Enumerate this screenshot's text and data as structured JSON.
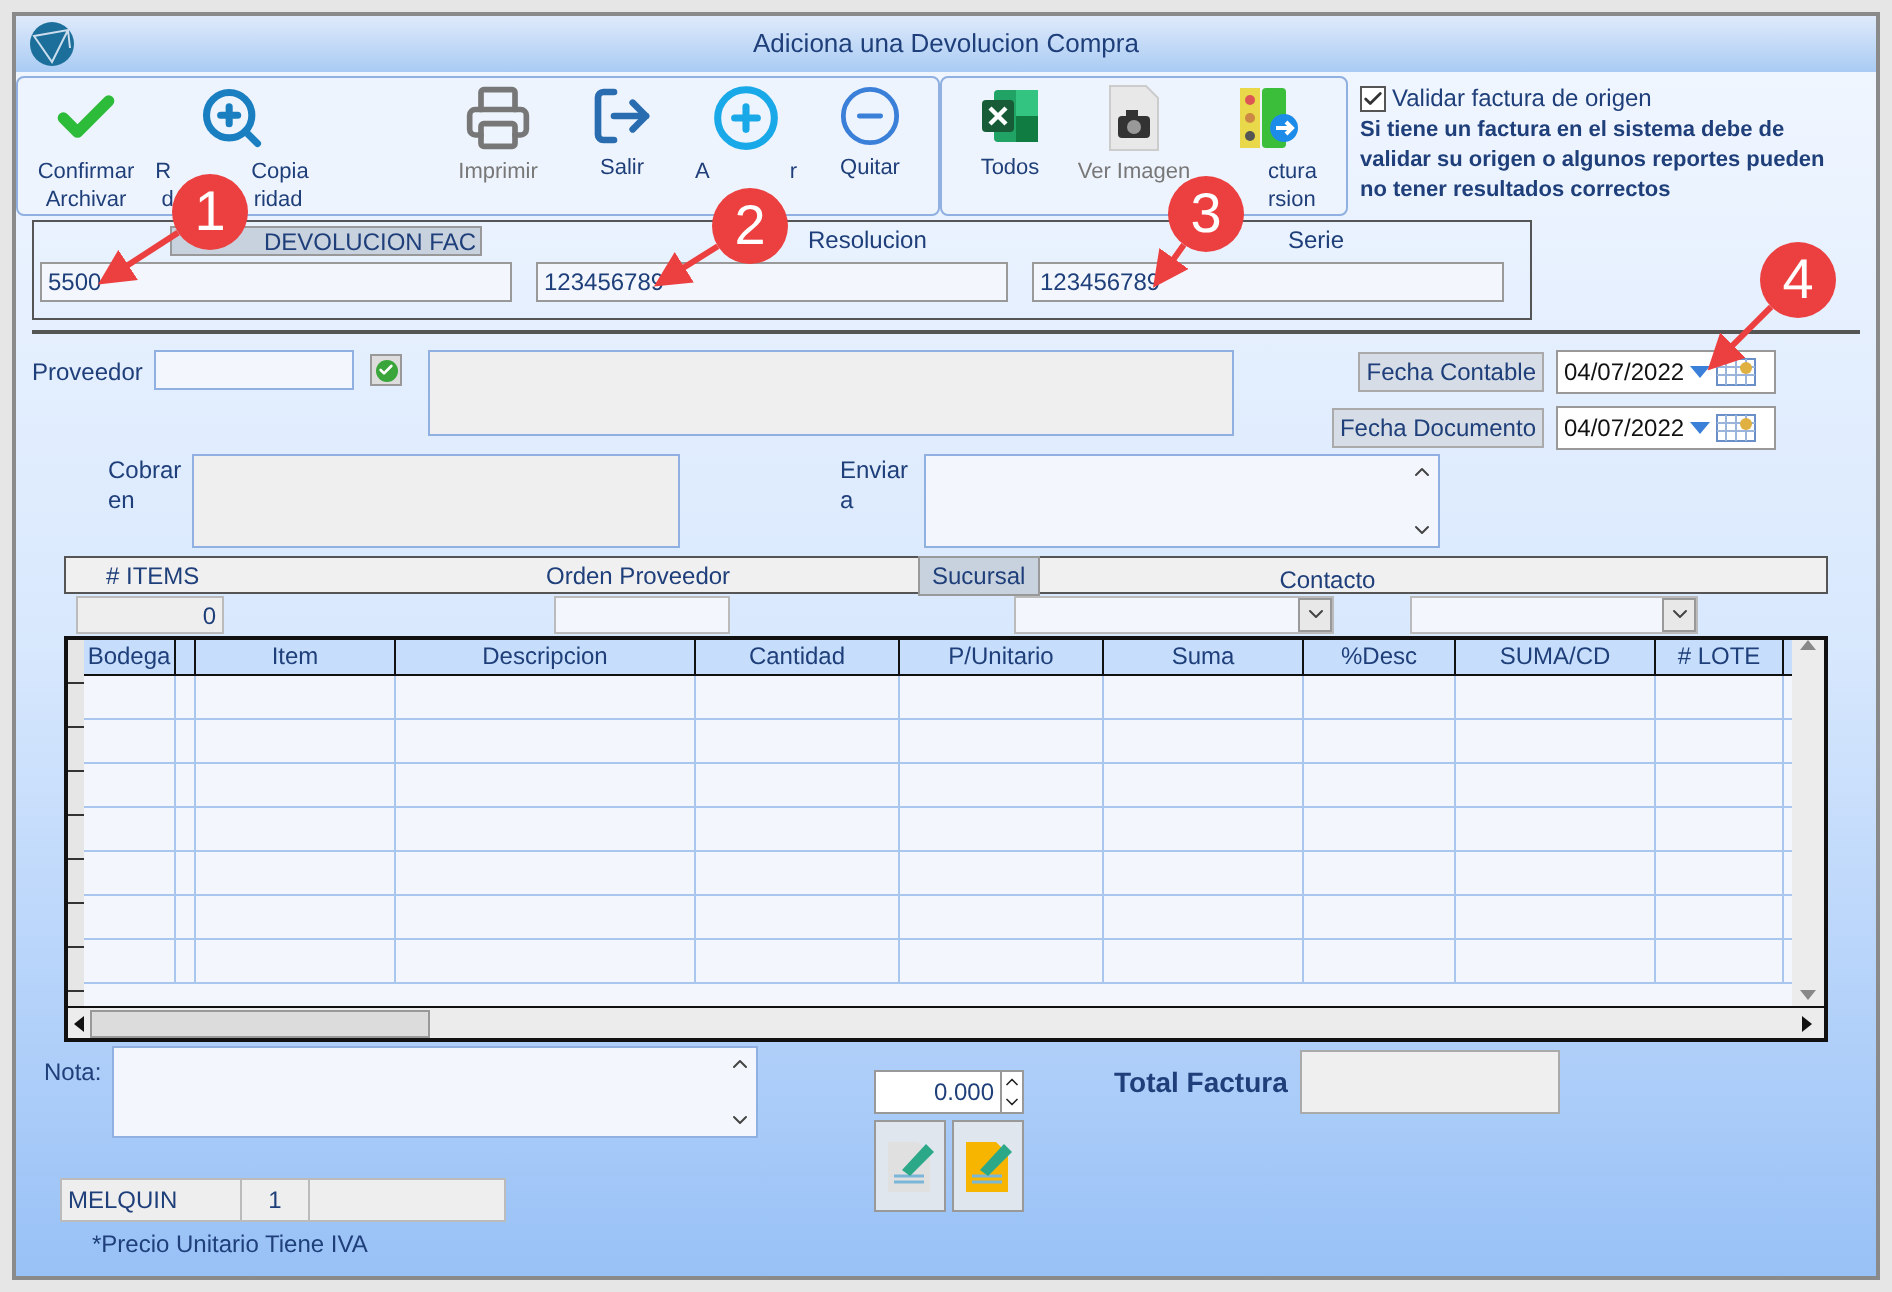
{
  "window": {
    "title": "Adiciona una Devolucion Compra"
  },
  "toolbar_groups": [
    {
      "buttons": [
        {
          "kind": "confirm",
          "lines": [
            [
              "Confirmar"
            ],
            [
              "Archivar"
            ]
          ],
          "disabled": false
        },
        {
          "kind": "backup",
          "lines": [
            [
              "R",
              "Copia"
            ],
            [
              "d",
              "ridad"
            ]
          ],
          "disabled": false
        },
        {
          "kind": "spacer"
        },
        {
          "kind": "print",
          "lines": [
            [
              "Imprimir"
            ]
          ],
          "disabled": true
        },
        {
          "kind": "exit",
          "lines": [
            [
              "Salir"
            ]
          ],
          "disabled": false
        },
        {
          "kind": "add",
          "lines": [
            [
              "A",
              "r"
            ]
          ],
          "disabled": false
        },
        {
          "kind": "remove",
          "lines": [
            [
              "Quitar"
            ]
          ],
          "disabled": false
        }
      ]
    },
    {
      "buttons": [
        {
          "kind": "excel",
          "lines": [
            [
              "Todos"
            ]
          ],
          "disabled": false
        },
        {
          "kind": "image",
          "lines": [
            [
              "Ver Imagen"
            ]
          ],
          "disabled": true
        },
        {
          "kind": "convert",
          "lines": [
            [
              "ctura"
            ],
            [
              "rsion"
            ]
          ],
          "disabled": false
        }
      ]
    }
  ],
  "validation": {
    "label": "Validar factura de origen",
    "checked": true,
    "message": "Si tiene un factura en el sistema debe de validar su origen o algunos reportes pueden no tener resultados correctos"
  },
  "document_fields": [
    {
      "label": "DEVOLUCION FAC",
      "value": "5500",
      "boxed": true
    },
    {
      "label": "Resolucion",
      "value": "123456789",
      "boxed": false
    },
    {
      "label": "Serie",
      "value": "123456789",
      "boxed": false
    }
  ],
  "supplier": {
    "label": "Proveedor"
  },
  "dates": [
    {
      "label": "Fecha Contable",
      "value": "04/07/2022"
    },
    {
      "label": "Fecha Documento",
      "value": "04/07/2022"
    }
  ],
  "addresses": [
    {
      "label": "Cobrar en",
      "kind": "plain"
    },
    {
      "label": "Enviar a",
      "kind": "scroll"
    }
  ],
  "header": {
    "items_label": "# ITEMS",
    "items_count": "0",
    "order_label": "Orden Proveedor",
    "branch_label": "Sucursal",
    "contact_label": "Contacto"
  },
  "table": {
    "columns": [
      "Bodega",
      "",
      "Item",
      "Descripcion",
      "Cantidad",
      "P/Unitario",
      "Suma",
      "%Desc",
      "SUMA/CD",
      "# LOTE"
    ]
  },
  "note": {
    "label": "Nota:"
  },
  "quantity": "0.000",
  "total": {
    "label": "Total Factura"
  },
  "status_bar": [
    "MELQUIN",
    "1"
  ],
  "footnote": "*Precio Unitario Tiene IVA",
  "annotations": [
    {
      "number": "1"
    },
    {
      "number": "2"
    },
    {
      "number": "3"
    },
    {
      "number": "4"
    }
  ]
}
